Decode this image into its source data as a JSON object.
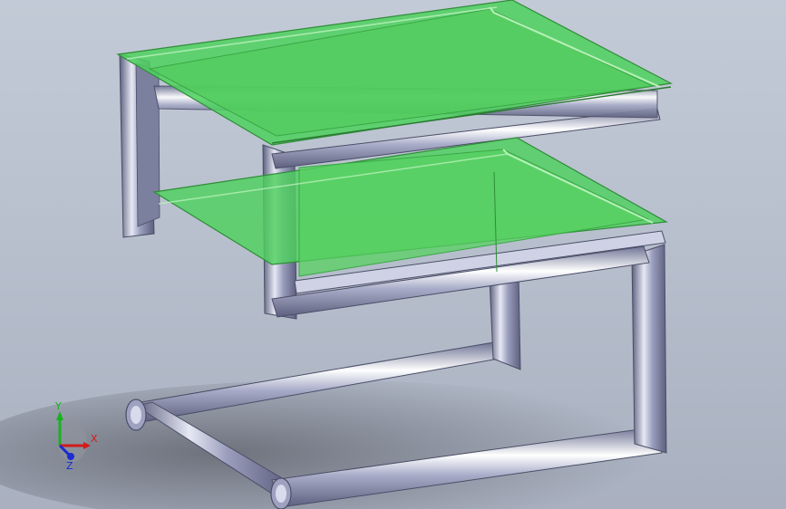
{
  "viewport": {
    "colors": {
      "background_top": "#c3cad7",
      "background_bottom": "#a9b0bf",
      "frame_metal": "#8f93b3",
      "glass": "#4ed15e"
    }
  },
  "triad": {
    "x_label": "X",
    "y_label": "Y",
    "z_label": "Z",
    "colors": {
      "x": "#d11a1a",
      "y": "#17b21f",
      "z": "#1a2bd1"
    }
  }
}
